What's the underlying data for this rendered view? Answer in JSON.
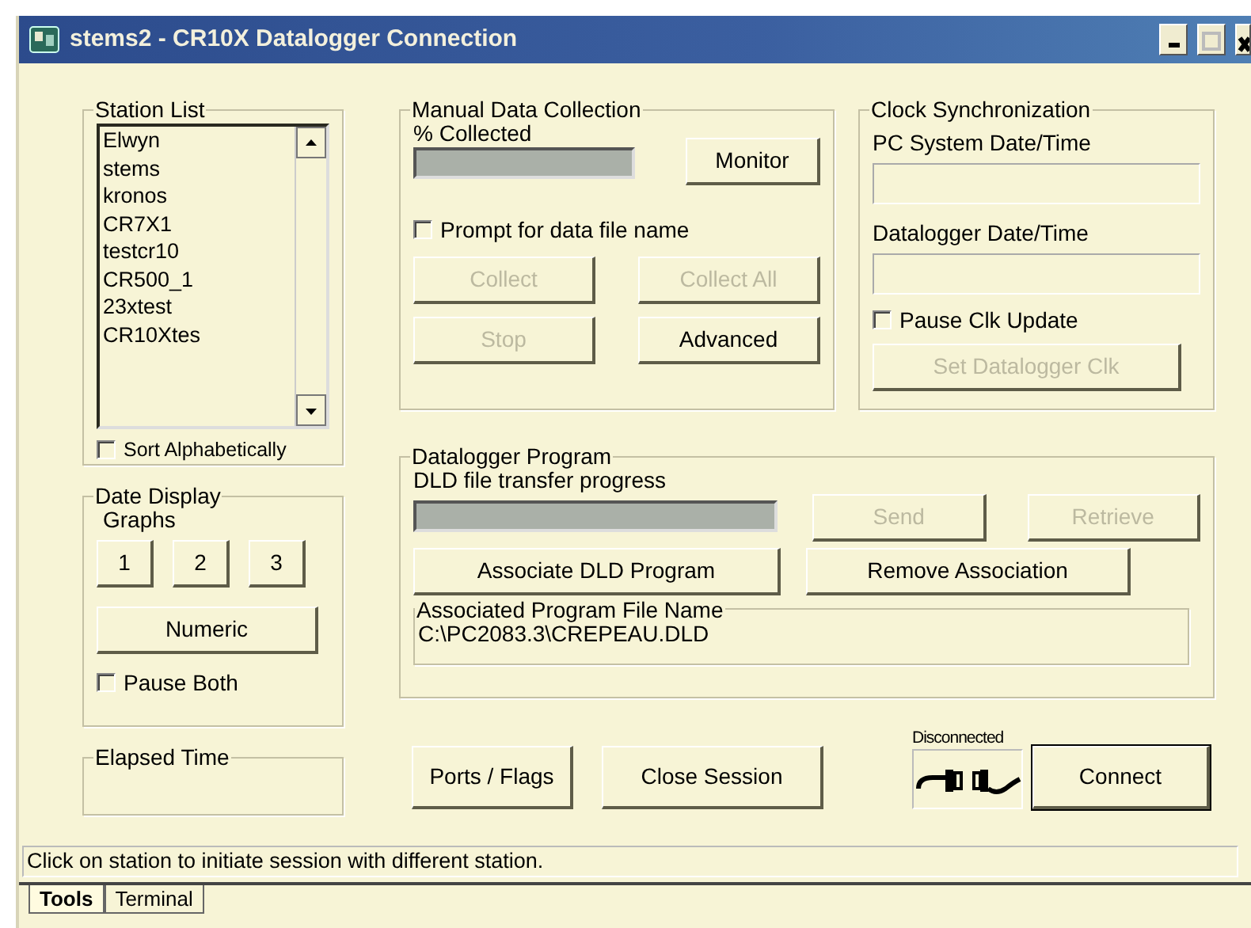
{
  "window": {
    "title": "stems2 - CR10X Datalogger Connection"
  },
  "station_list": {
    "title": "Station List",
    "items": [
      {
        "label": "Elwyn",
        "selected": false
      },
      {
        "label": "stems",
        "selected": false
      },
      {
        "label": "kronos",
        "selected": false
      },
      {
        "label": "CR7X1",
        "selected": false
      },
      {
        "label": "testcr10",
        "selected": false
      },
      {
        "label": "CR500_1",
        "selected": false
      },
      {
        "label": "23xtest",
        "selected": false
      },
      {
        "label": "CR10Xtes",
        "selected": false
      }
    ],
    "sort": {
      "label": "Sort Alphabetically",
      "checked": false
    }
  },
  "date_display": {
    "title": "Date Display",
    "graphs_label": "Graphs",
    "graph_buttons": [
      "1",
      "2",
      "3"
    ],
    "numeric_button": "Numeric",
    "pause": {
      "label": "Pause Both",
      "checked": false
    }
  },
  "elapsed_time": {
    "title": "Elapsed Time"
  },
  "manual_collection": {
    "title": "Manual Data Collection",
    "progress_label": "% Collected",
    "progress": {
      "level": 0
    },
    "monitor_button": "Monitor",
    "prompt": {
      "label": "Prompt for data file name",
      "checked": false
    },
    "buttons": [
      {
        "label": "Collect",
        "disabled": true
      },
      {
        "label": "Collect All",
        "disabled": true
      },
      {
        "label": "Stop",
        "disabled": true
      },
      {
        "label": "Advanced",
        "disabled": false
      }
    ]
  },
  "clock_sync": {
    "title": "Clock Synchronization",
    "pc_label": "PC System Date/Time",
    "logger_label": "Datalogger Date/Time",
    "pause": {
      "label": "Pause Clk Update",
      "checked": false
    },
    "set_button": {
      "label": "Set Datalogger Clk",
      "disabled": true
    }
  },
  "datalogger_program": {
    "title": "Datalogger Program",
    "progress_label": "DLD file transfer progress",
    "progress": {
      "level": 0
    },
    "buttons": [
      {
        "label": "Send",
        "disabled": true
      },
      {
        "label": "Retrieve",
        "disabled": true
      },
      {
        "label": "Associate DLD Program",
        "disabled": false
      },
      {
        "label": "Remove Association",
        "disabled": false
      }
    ],
    "file_title": "Associated Program File Name",
    "file_path": "C:\\PC2083.3\\CREPEAU.DLD"
  },
  "bottom_buttons": [
    "Ports / Flags",
    "Close Session"
  ],
  "connection": {
    "status": "Disconnected",
    "button": "Connect"
  },
  "status_bar": "Click on station to initiate session with different station.",
  "tabs": [
    {
      "label": "Tools",
      "selected": true
    },
    {
      "label": "Terminal",
      "selected": false
    }
  ]
}
